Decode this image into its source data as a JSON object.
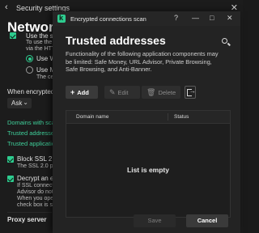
{
  "background": {
    "back_label": "Security settings",
    "page_title": "Network",
    "option_use_label": "Use the se",
    "option_use_desc_1": "To use the c",
    "option_use_desc_2": "via the HTTP",
    "radio_1_label": "Use Wi",
    "radio_2_label": "Use Mc",
    "radio_2_desc": "The certi",
    "when_encrypted_label": "When encrypted co",
    "ask_value": "Ask",
    "link_domains": "Domains with scan",
    "link_trusted": "Trusted addresses",
    "link_trusted_apps": "Trusted application",
    "block_ssl_label": "Block SSL 2.0 co",
    "block_ssl_desc": "The SSL 2.0 proto",
    "decrypt_label": "Decrypt an enc",
    "decrypt_desc_1": "If SSL connection",
    "decrypt_desc_2": "Advisor do not sc",
    "decrypt_desc_3": "When you open a",
    "decrypt_desc_4": "check box is selec",
    "proxy_label": "Proxy server"
  },
  "dialog": {
    "window_title": "Encrypted connections scan",
    "controls": {
      "help": "?",
      "minimize": "—",
      "maximize": "□",
      "close": "✕"
    },
    "heading": "Trusted addresses",
    "description": "Functionality of the following application components may be limited: Safe Money, URL Advisor, Private Browsing, Safe Browsing, and Anti-Banner.",
    "toolbar": {
      "add_label": "Add",
      "edit_label": "Edit",
      "delete_label": "Delete"
    },
    "table": {
      "columns": [
        "Domain name",
        "Status"
      ],
      "rows": [],
      "empty_message": "List is empty"
    },
    "footer": {
      "save_label": "Save",
      "cancel_label": "Cancel"
    }
  }
}
